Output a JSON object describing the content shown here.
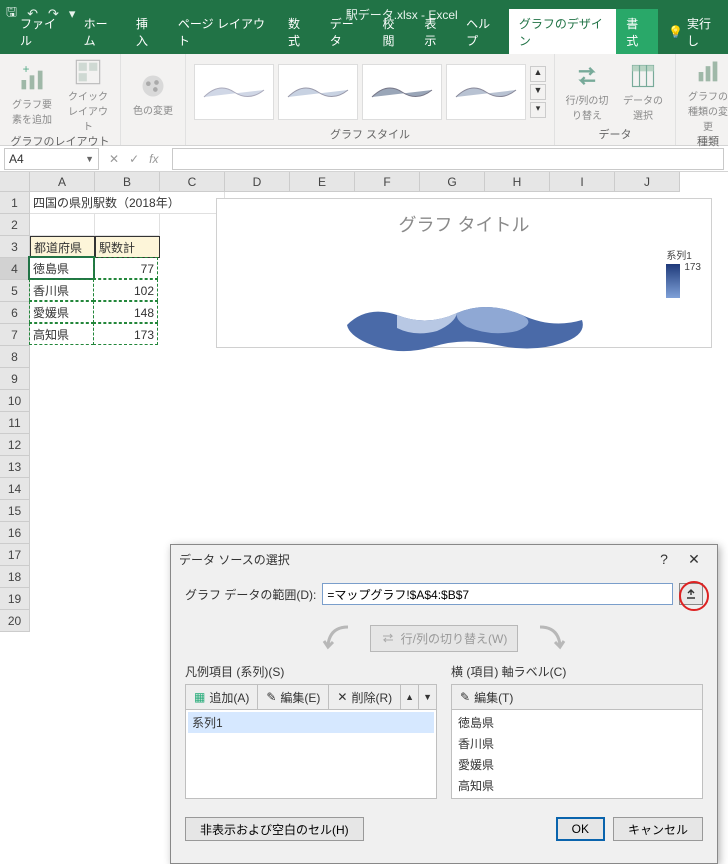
{
  "title": "駅データ.xlsx - Excel",
  "tabs": [
    "ファイル",
    "ホーム",
    "挿入",
    "ページ レイアウト",
    "数式",
    "データ",
    "校閲",
    "表示",
    "ヘルプ"
  ],
  "context_tabs": {
    "design": "グラフのデザイン",
    "format": "書式"
  },
  "tellme": "実行し",
  "ribbon": {
    "layout_group": "グラフのレイアウト",
    "add_element": "グラフ要素を追加",
    "quick_layout": "クイックレイアウト",
    "color_change": "色の変更",
    "styles_group": "グラフ スタイル",
    "data_group": "データ",
    "switch_rowcol": "行/列の切り替え",
    "select_data": "データの選択",
    "type_group": "種類",
    "change_type": "グラフの種類の変更"
  },
  "namebox": "A4",
  "columns": [
    "A",
    "B",
    "C",
    "D",
    "E",
    "F",
    "G",
    "H",
    "I",
    "J"
  ],
  "rows": 20,
  "sheet": {
    "a1": "四国の県別駅数（2018年）",
    "a3": "都道府県",
    "b3": "駅数計",
    "a4": "徳島県",
    "b4": "77",
    "a5": "香川県",
    "b5": "102",
    "a6": "愛媛県",
    "b6": "148",
    "a7": "高知県",
    "b7": "173"
  },
  "chart": {
    "title": "グラフ タイトル",
    "legend": "系列1",
    "scale_max": "173"
  },
  "dialog": {
    "title": "データ ソースの選択",
    "help": "?",
    "range_label": "グラフ データの範囲(D):",
    "range_value": "=マップグラフ!$A$4:$B$7",
    "swap": "行/列の切り替え(W)",
    "series_label": "凡例項目 (系列)(S)",
    "series_add": "追加(A)",
    "series_edit": "編集(E)",
    "series_remove": "削除(R)",
    "series_items": [
      "系列1"
    ],
    "axis_label": "横 (項目) 軸ラベル(C)",
    "axis_edit": "編集(T)",
    "axis_items": [
      "徳島県",
      "香川県",
      "愛媛県",
      "高知県"
    ],
    "hidden_cells": "非表示および空白のセル(H)",
    "ok": "OK",
    "cancel": "キャンセル"
  },
  "chart_data": {
    "type": "map",
    "title": "グラフ タイトル",
    "series": [
      {
        "name": "系列1",
        "categories": [
          "徳島県",
          "香川県",
          "愛媛県",
          "高知県"
        ],
        "values": [
          77,
          102,
          148,
          173
        ]
      }
    ],
    "scale_max": 173
  }
}
